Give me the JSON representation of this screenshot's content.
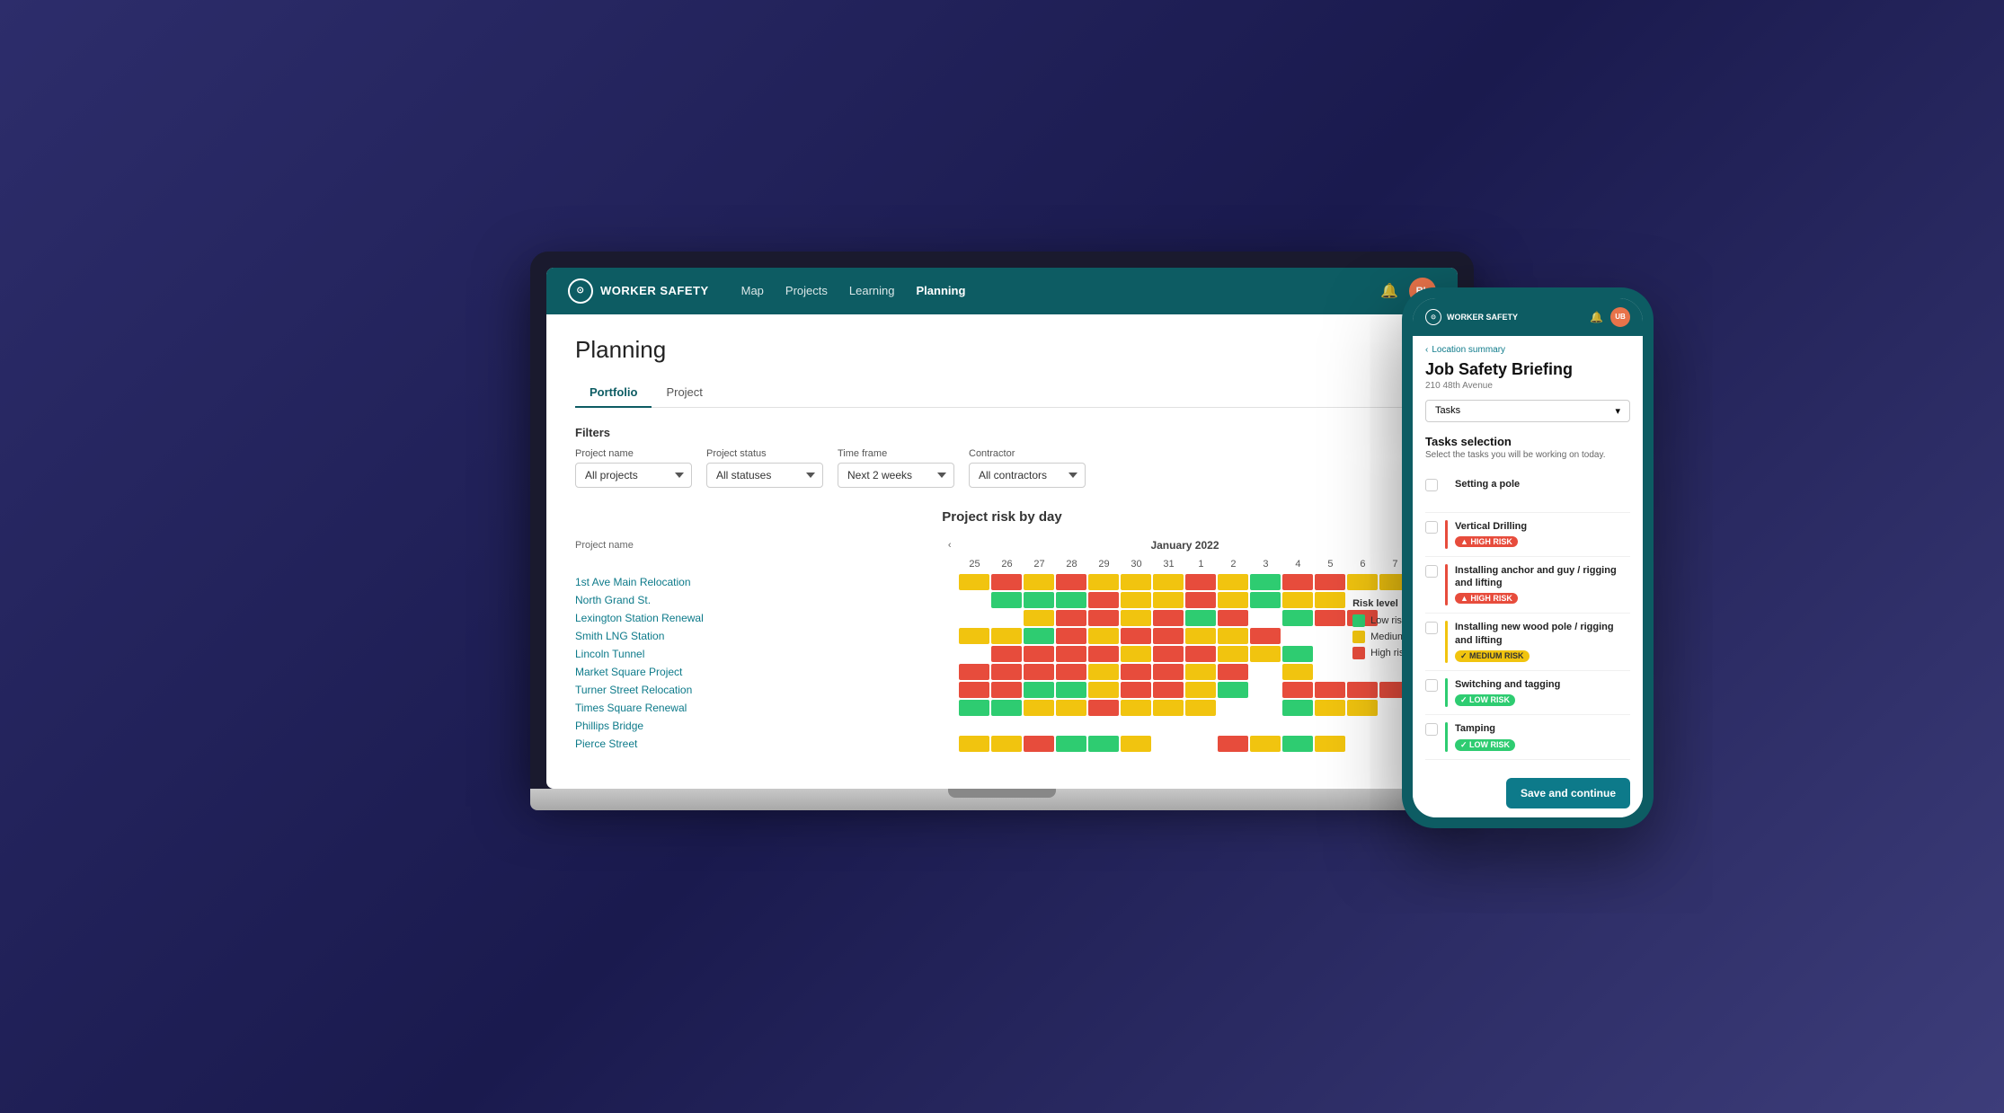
{
  "app": {
    "name": "WORKER SAFETY",
    "nav": {
      "links": [
        {
          "label": "Map",
          "active": false
        },
        {
          "label": "Projects",
          "active": false
        },
        {
          "label": "Learning",
          "active": false
        },
        {
          "label": "Planning",
          "active": true
        }
      ],
      "bell_label": "🔔",
      "avatar": "RL"
    }
  },
  "planning": {
    "title": "Planning",
    "tabs": [
      {
        "label": "Portfolio",
        "active": true
      },
      {
        "label": "Project",
        "active": false
      }
    ],
    "filters": {
      "label": "Filters",
      "project_name": {
        "label": "Project name",
        "value": "All projects"
      },
      "project_status": {
        "label": "Project status",
        "value": "All statuses"
      },
      "time_frame": {
        "label": "Time frame",
        "value": "Next 2 weeks"
      },
      "contractor": {
        "label": "Contractor",
        "value": "All contractors"
      }
    },
    "calendar": {
      "title": "Project risk by day",
      "month": "January 2022",
      "days": [
        25,
        26,
        27,
        28,
        29,
        30,
        31,
        1,
        2,
        3,
        4,
        5,
        6,
        7
      ],
      "projects": [
        {
          "name": "1st Ave Main Relocation",
          "days": [
            "yellow",
            "red",
            "yellow",
            "red",
            "yellow",
            "yellow",
            "yellow",
            "red",
            "yellow",
            "green",
            "red",
            "red",
            "yellow",
            "yellow"
          ]
        },
        {
          "name": "North Grand St.",
          "days": [
            "empty",
            "green",
            "green",
            "green",
            "red",
            "yellow",
            "yellow",
            "red",
            "yellow",
            "green",
            "yellow",
            "yellow",
            "empty",
            "empty"
          ]
        },
        {
          "name": "Lexington Station Renewal",
          "days": [
            "empty",
            "empty",
            "yellow",
            "red",
            "red",
            "yellow",
            "red",
            "green",
            "red",
            "empty",
            "green",
            "red",
            "red",
            "empty"
          ]
        },
        {
          "name": "Smith LNG Station",
          "days": [
            "yellow",
            "yellow",
            "green",
            "red",
            "yellow",
            "red",
            "red",
            "yellow",
            "yellow",
            "red",
            "empty",
            "empty",
            "empty",
            "empty"
          ]
        },
        {
          "name": "Lincoln Tunnel",
          "days": [
            "empty",
            "red",
            "red",
            "red",
            "red",
            "yellow",
            "red",
            "red",
            "yellow",
            "yellow",
            "green",
            "empty",
            "empty",
            "empty"
          ]
        },
        {
          "name": "Market Square Project",
          "days": [
            "red",
            "red",
            "red",
            "red",
            "yellow",
            "red",
            "red",
            "yellow",
            "red",
            "empty",
            "yellow",
            "empty",
            "empty",
            "empty"
          ]
        },
        {
          "name": "Turner Street Relocation",
          "days": [
            "red",
            "red",
            "green",
            "green",
            "yellow",
            "red",
            "red",
            "yellow",
            "green",
            "empty",
            "red",
            "red",
            "red",
            "red"
          ]
        },
        {
          "name": "Times Square Renewal",
          "days": [
            "green",
            "green",
            "yellow",
            "yellow",
            "red",
            "yellow",
            "yellow",
            "yellow",
            "empty",
            "empty",
            "green",
            "yellow",
            "yellow",
            "empty"
          ]
        },
        {
          "name": "Phillips Bridge",
          "days": [
            "empty",
            "empty",
            "empty",
            "empty",
            "empty",
            "empty",
            "empty",
            "empty",
            "empty",
            "empty",
            "empty",
            "empty",
            "empty",
            "empty"
          ]
        },
        {
          "name": "Pierce Street",
          "days": [
            "yellow",
            "yellow",
            "red",
            "green",
            "green",
            "yellow",
            "empty",
            "empty",
            "red",
            "yellow",
            "green",
            "yellow",
            "empty",
            "empty"
          ]
        }
      ]
    },
    "risk_legend": {
      "title": "Risk level",
      "items": [
        {
          "label": "Low risk",
          "color": "green"
        },
        {
          "label": "Medium A",
          "color": "yellow"
        },
        {
          "label": "High risk",
          "color": "red"
        }
      ]
    }
  },
  "phone": {
    "app_name": "WORKER SAFETY",
    "avatar": "UB",
    "back_link": "Location summary",
    "title": "Job Safety Briefing",
    "subtitle": "210 48th Avenue",
    "dropdown": {
      "label": "Tasks",
      "placeholder": "Tasks"
    },
    "tasks_selection": {
      "title": "Tasks selection",
      "subtitle": "Select the tasks you will be working on today.",
      "tasks": [
        {
          "name": "Setting a pole",
          "bar": "none",
          "badge": null,
          "badge_type": null
        },
        {
          "name": "Vertical Drilling",
          "bar": "red",
          "badge": "HIGH RISK",
          "badge_type": "high"
        },
        {
          "name": "Installing anchor and guy / rigging and lifting",
          "bar": "red",
          "badge": "HIGH RISK",
          "badge_type": "high"
        },
        {
          "name": "Installing new wood pole / rigging and lifting",
          "bar": "yellow",
          "badge": "MEDIUM RISK",
          "badge_type": "medium"
        },
        {
          "name": "Switching and tagging",
          "bar": "green",
          "badge": "LOW RISK",
          "badge_type": "low"
        },
        {
          "name": "Tamping",
          "bar": "green",
          "badge": "LOW RISK",
          "badge_type": "low"
        }
      ]
    },
    "save_continue": "Save and continue"
  }
}
